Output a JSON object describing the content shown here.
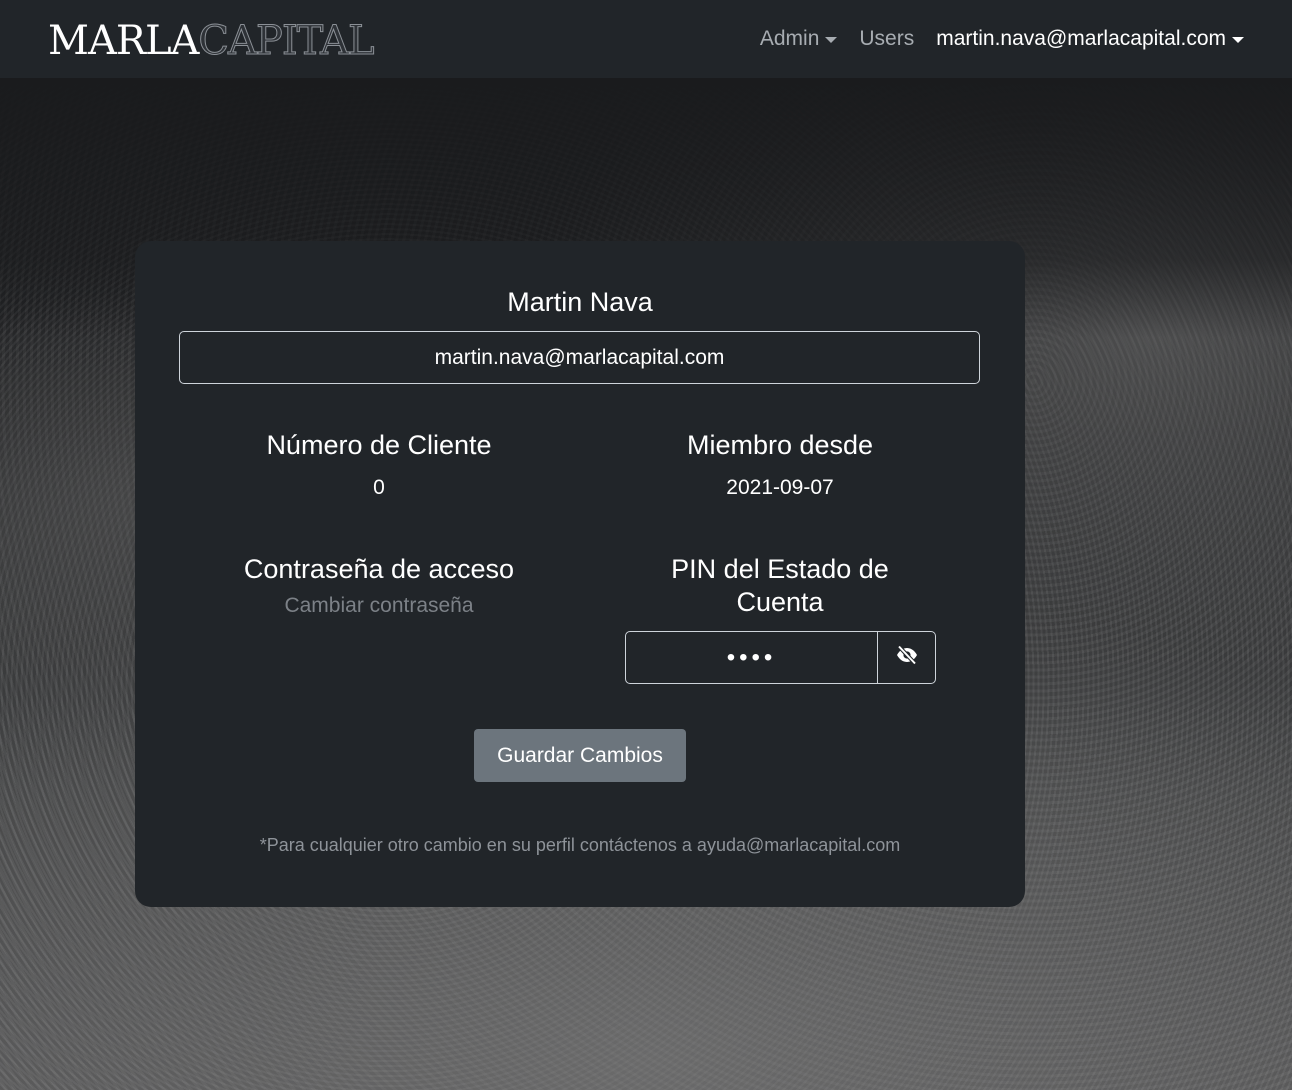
{
  "navbar": {
    "brand_part1": "MARLA",
    "brand_part2": "CAPITAL",
    "admin_label": "Admin",
    "users_label": "Users",
    "account_label": "martin.nava@marlacapital.com"
  },
  "profile": {
    "name": "Martin Nava",
    "email": "martin.nava@marlacapital.com",
    "client_number_heading": "Número de Cliente",
    "client_number_value": "0",
    "member_since_heading": "Miembro desde",
    "member_since_value": "2021-09-07",
    "password_heading": "Contraseña de acceso",
    "change_password_link": "Cambiar contraseña",
    "pin_heading": "PIN del Estado de Cuenta",
    "pin_value": "••••",
    "save_button": "Guardar Cambios",
    "footnote": "*Para cualquier otro cambio en su perfil contáctenos a ayuda@marlacapital.com"
  },
  "icons": {
    "pin_toggle": "eye-slash-icon"
  }
}
